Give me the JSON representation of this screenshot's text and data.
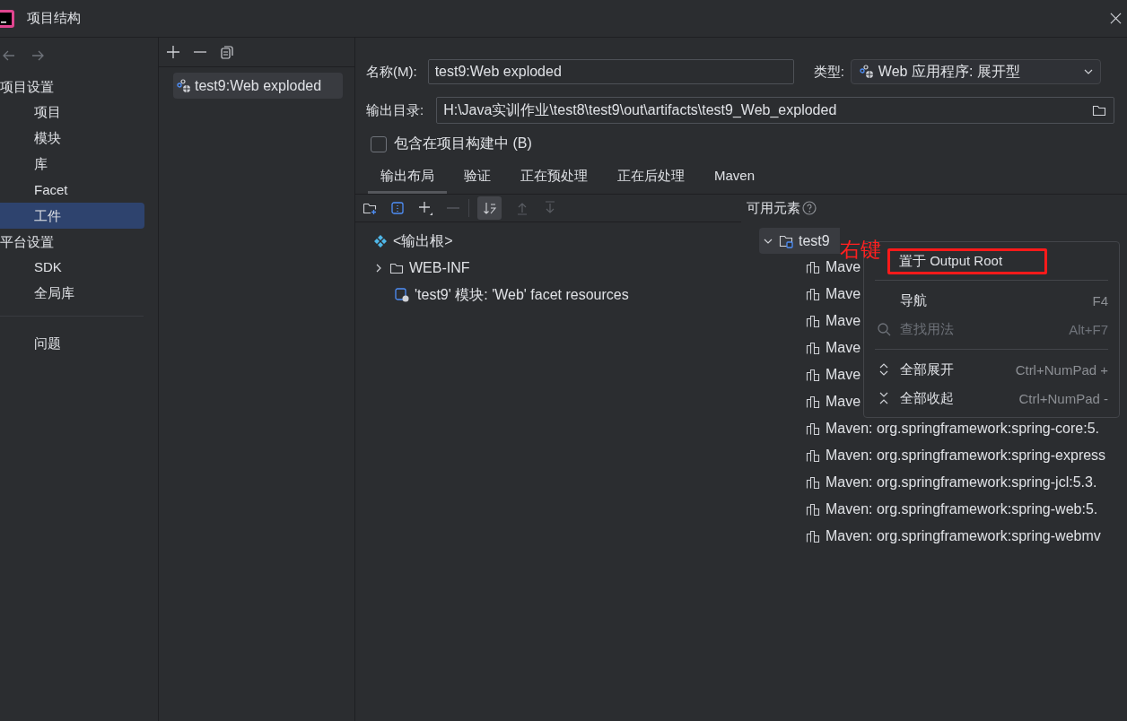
{
  "window": {
    "title": "项目结构"
  },
  "sidebar": {
    "sections": [
      {
        "header": "项目设置",
        "items": [
          {
            "label": "项目",
            "selected": false
          },
          {
            "label": "模块",
            "selected": false
          },
          {
            "label": "库",
            "selected": false
          },
          {
            "label": "Facet",
            "selected": false
          },
          {
            "label": "工件",
            "selected": true
          }
        ]
      },
      {
        "header": "平台设置",
        "items": [
          {
            "label": "SDK",
            "selected": false
          },
          {
            "label": "全局库",
            "selected": false
          }
        ]
      },
      {
        "items": [
          {
            "label": "问题",
            "selected": false
          }
        ]
      }
    ]
  },
  "artifacts": {
    "items": [
      {
        "label": "test9:Web exploded",
        "selected": true
      }
    ]
  },
  "form": {
    "name_label": "名称(M):",
    "name_value": "test9:Web exploded",
    "type_label": "类型:",
    "type_value": "Web 应用程序: 展开型",
    "output_label": "输出目录:",
    "output_value": "H:\\Java实训作业\\test8\\test9\\out\\artifacts\\test9_Web_exploded",
    "include_label": "包含在项目构建中 (B)",
    "include_checked": false
  },
  "tabs": [
    {
      "label": "输出布局",
      "selected": true
    },
    {
      "label": "验证",
      "selected": false
    },
    {
      "label": "正在预处理",
      "selected": false
    },
    {
      "label": "正在后处理",
      "selected": false
    },
    {
      "label": "Maven",
      "selected": false
    }
  ],
  "layout_tree": [
    {
      "kind": "root",
      "label": "<输出根>"
    },
    {
      "kind": "folder",
      "label": "WEB-INF",
      "expanded": false
    },
    {
      "kind": "module",
      "label": "'test9' 模块: 'Web' facet resources"
    }
  ],
  "available": {
    "title": "可用元素",
    "root": {
      "label": "test9",
      "expanded": true,
      "selected": true
    },
    "rows": [
      "Mave",
      "Mave",
      "Mave",
      "Mave",
      "Mave",
      "Mave",
      "Maven: org.springframework:spring-core:5.",
      "Maven: org.springframework:spring-express",
      "Maven: org.springframework:spring-jcl:5.3.",
      "Maven: org.springframework:spring-web:5.",
      "Maven: org.springframework:spring-webmv"
    ]
  },
  "context_menu": [
    {
      "kind": "plain",
      "label": "置于 Output Root",
      "disabled": false,
      "highlighted": true
    },
    {
      "kind": "separator"
    },
    {
      "kind": "plain",
      "label": "导航",
      "shortcut": "F4",
      "disabled": false,
      "highlighted": false
    },
    {
      "kind": "search",
      "label": "查找用法",
      "shortcut": "Alt+F7",
      "disabled": true,
      "highlighted": false
    },
    {
      "kind": "separator"
    },
    {
      "kind": "expand",
      "label": "全部展开",
      "shortcut": "Ctrl+NumPad +",
      "disabled": false,
      "highlighted": false
    },
    {
      "kind": "collapse",
      "label": "全部收起",
      "shortcut": "Ctrl+NumPad -",
      "disabled": false,
      "highlighted": false
    }
  ],
  "annotation": {
    "text": "右键"
  }
}
